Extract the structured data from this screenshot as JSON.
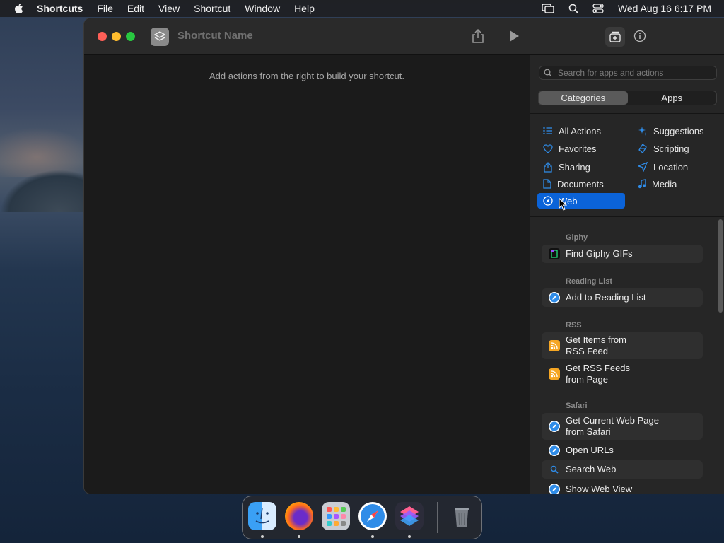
{
  "menubar": {
    "app_name": "Shortcuts",
    "items": [
      "File",
      "Edit",
      "View",
      "Shortcut",
      "Window",
      "Help"
    ],
    "clock": "Wed Aug 16  6:17 PM"
  },
  "editor": {
    "name_placeholder": "Shortcut Name",
    "empty_hint": "Add actions from the right to build your shortcut."
  },
  "sidebar": {
    "search_placeholder": "Search for apps and actions",
    "tabs": [
      "Categories",
      "Apps"
    ],
    "categories_left": [
      "All Actions",
      "Favorites",
      "Sharing",
      "Documents",
      "Web"
    ],
    "categories_right": [
      "Suggestions",
      "Scripting",
      "Location",
      "Media"
    ],
    "selected_category": "Web",
    "sections": {
      "giphy": "Giphy",
      "reading_list": "Reading List",
      "rss": "RSS",
      "safari": "Safari"
    },
    "actions": {
      "find_giphy": "Find Giphy GIFs",
      "add_reading_list": "Add to Reading List",
      "rss_items_1": "Get Items from",
      "rss_items_2": "RSS Feed",
      "rss_feeds_1": "Get RSS Feeds",
      "rss_feeds_2": "from Page",
      "current_page_1": "Get Current Web Page",
      "current_page_2": "from Safari",
      "open_urls": "Open URLs",
      "search_web": "Search Web",
      "show_web_view": "Show Web View"
    }
  },
  "colors": {
    "accent": "#0b63d8",
    "rss": "#f5a623",
    "safari": "#2f8ce8"
  },
  "dock": [
    "finder",
    "firefox",
    "launchpad",
    "safari",
    "shortcuts",
    "trash"
  ]
}
